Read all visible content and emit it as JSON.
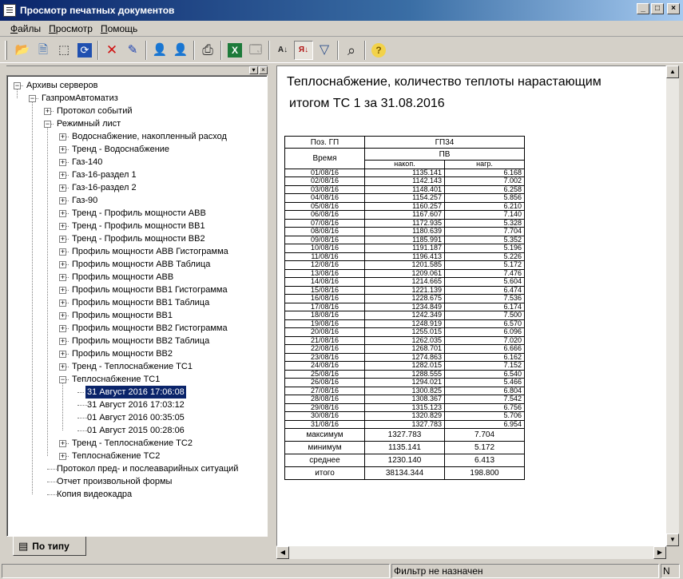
{
  "window": {
    "title": "Просмотр печатных документов",
    "minimize_glyph": "_",
    "maximize_glyph": "□",
    "close_glyph": "×"
  },
  "menu": {
    "items": [
      "Файлы",
      "Просмотр",
      "Помощь"
    ]
  },
  "toolbar": {
    "icons": [
      "open-folder-icon",
      "print-preview-icon",
      "select-area-icon",
      "refresh-icon",
      "delete-icon",
      "connect-icon",
      "user-add-icon",
      "user-remove-icon",
      "printer-icon",
      "excel-export-icon",
      "properties-icon",
      "sort-ascending-icon",
      "sort-descending-icon",
      "filter-icon",
      "search-icon",
      "help-icon"
    ],
    "glyphs": {
      "open-folder-icon": "📂",
      "print-preview-icon": "🗎",
      "select-area-icon": "⬚",
      "refresh-icon": "⟳",
      "delete-icon": "✕",
      "connect-icon": "✎",
      "user-add-icon": "👤",
      "user-remove-icon": "👤",
      "printer-icon": "⎙",
      "excel-export-icon": "X",
      "properties-icon": "🗔",
      "sort-ascending-icon": "A↓",
      "sort-descending-icon": "Я↓",
      "filter-icon": "▽",
      "search-icon": "⌕",
      "help-icon": "?"
    }
  },
  "panel": {
    "pin_glyph": "▾",
    "close_glyph": "×"
  },
  "tree": {
    "root": "Архивы серверов",
    "server": "ГазпромАвтоматиз",
    "events": "Протокол событий",
    "regime": "Режимный лист",
    "regime_children": [
      "Водоснабжение, накопленный расход",
      "Тренд - Водоснабжение",
      "Газ-140",
      "Газ-16-раздел 1",
      "Газ-16-раздел 2",
      "Газ-90",
      "Тренд - Профиль мощности ABB",
      "Тренд - Профиль мощности BB1",
      "Тренд - Профиль мощности BB2",
      "Профиль мощности ABB Гистограмма",
      "Профиль мощности ABB Таблица",
      "Профиль мощности ABB",
      "Профиль мощности BB1 Гистограмма",
      "Профиль мощности BB1 Таблица",
      "Профиль мощности BB1",
      "Профиль мощности BB2 Гистограмма",
      "Профиль мощности BB2 Таблица",
      "Профиль мощности BB2",
      "Тренд - Теплоснабжение TC1"
    ],
    "heat_tc1": "Теплоснабжение TC1",
    "heat_tc1_children": [
      "31 Август 2016 17:06:08",
      "31 Август 2016 17:03:12",
      "01 Август 2016 00:35:05",
      "01 Август 2015 00:28:06"
    ],
    "after_items": [
      "Тренд - Теплоснабжение TC2",
      "Теплоснабжение TC2"
    ],
    "server_tail": [
      "Протокол пред- и послеаварийных ситуаций",
      "Отчет произвольной формы",
      "Копия видеокадра"
    ]
  },
  "tab": {
    "label": "По типу",
    "icon": "document-tree-icon"
  },
  "report": {
    "title_line1": "Теплоснабжение, количество теплоты нарастающим",
    "title_line2": "итогом ТС 1 за  31.08.2016",
    "table": {
      "pos_label": "Поз. ГП",
      "pos_value": "ГП34",
      "time_label": "Время",
      "group_label": "ПВ",
      "col1_label": "накоп.",
      "col2_label": "нагр.",
      "rows": [
        [
          "01/08/16",
          "1135.141",
          "6.168"
        ],
        [
          "02/08/16",
          "1142.143",
          "7.002"
        ],
        [
          "03/08/16",
          "1148.401",
          "6.258"
        ],
        [
          "04/08/16",
          "1154.257",
          "5.856"
        ],
        [
          "05/08/16",
          "1160.257",
          "6.210"
        ],
        [
          "06/08/16",
          "1167.607",
          "7.140"
        ],
        [
          "07/08/16",
          "1172.935",
          "5.328"
        ],
        [
          "08/08/16",
          "1180.639",
          "7.704"
        ],
        [
          "09/08/16",
          "1185.991",
          "5.352"
        ],
        [
          "10/08/16",
          "1191.187",
          "5.196"
        ],
        [
          "11/08/16",
          "1196.413",
          "5.226"
        ],
        [
          "12/08/16",
          "1201.585",
          "5.172"
        ],
        [
          "13/08/16",
          "1209.061",
          "7.476"
        ],
        [
          "14/08/16",
          "1214.665",
          "5.604"
        ],
        [
          "15/08/16",
          "1221.139",
          "6.474"
        ],
        [
          "16/08/16",
          "1228.675",
          "7.536"
        ],
        [
          "17/08/16",
          "1234.849",
          "6.174"
        ],
        [
          "18/08/16",
          "1242.349",
          "7.500"
        ],
        [
          "19/08/16",
          "1248.919",
          "6.570"
        ],
        [
          "20/08/16",
          "1255.015",
          "6.096"
        ],
        [
          "21/08/16",
          "1262.035",
          "7.020"
        ],
        [
          "22/08/16",
          "1268.701",
          "6.666"
        ],
        [
          "23/08/16",
          "1274.863",
          "6.162"
        ],
        [
          "24/08/16",
          "1282.015",
          "7.152"
        ],
        [
          "25/08/16",
          "1288.555",
          "6.540"
        ],
        [
          "26/08/16",
          "1294.021",
          "5.466"
        ],
        [
          "27/08/16",
          "1300.825",
          "6.804"
        ],
        [
          "28/08/16",
          "1308.367",
          "7.542"
        ],
        [
          "29/08/16",
          "1315.123",
          "6.756"
        ],
        [
          "30/08/16",
          "1320.829",
          "5.706"
        ],
        [
          "31/08/16",
          "1327.783",
          "6.954"
        ]
      ],
      "summary": [
        [
          "максимум",
          "1327.783",
          "7.704"
        ],
        [
          "минимум",
          "1135.141",
          "5.172"
        ],
        [
          "среднее",
          "1230.140",
          "6.413"
        ],
        [
          "итого",
          "38134.344",
          "198.800"
        ]
      ]
    }
  },
  "scrollbars": {
    "up": "▲",
    "down": "▼",
    "left": "◀",
    "right": "▶"
  },
  "status": {
    "filter": "Фильтр не назначен",
    "mode": "N"
  }
}
